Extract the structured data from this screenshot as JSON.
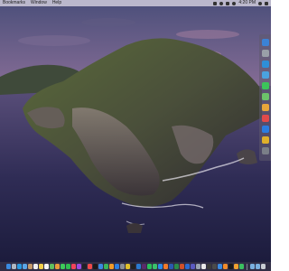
{
  "menubar": {
    "items": [
      "Bookmarks",
      "Window",
      "Help"
    ],
    "clock": "4:20 PM"
  },
  "side_dock": {
    "icons": [
      {
        "name": "finder-icon",
        "color": "#3b82d6"
      },
      {
        "name": "launchpad-icon",
        "color": "#9aa0a8"
      },
      {
        "name": "safari-icon",
        "color": "#2f8fd8"
      },
      {
        "name": "mail-icon",
        "color": "#4aa3e0"
      },
      {
        "name": "messages-icon",
        "color": "#3cc45a"
      },
      {
        "name": "maps-icon",
        "color": "#6cc36a"
      },
      {
        "name": "photos-icon",
        "color": "#e8a63a"
      },
      {
        "name": "calendar-icon",
        "color": "#e24a4a"
      },
      {
        "name": "app-store-icon",
        "color": "#2b7de0"
      },
      {
        "name": "chrome-icon",
        "color": "#e0b02a"
      },
      {
        "name": "settings-icon",
        "color": "#7b7f88"
      }
    ]
  },
  "dock": {
    "icons": [
      {
        "name": "finder-icon",
        "color": "#3a8be0"
      },
      {
        "name": "launchpad-icon",
        "color": "#b0b6c0"
      },
      {
        "name": "safari-icon",
        "color": "#2a9ae0"
      },
      {
        "name": "mail-icon",
        "color": "#5aa5e5"
      },
      {
        "name": "contacts-icon",
        "color": "#c49a6a"
      },
      {
        "name": "calendar-icon",
        "color": "#f0f0f0"
      },
      {
        "name": "notes-icon",
        "color": "#f2d04a"
      },
      {
        "name": "reminders-icon",
        "color": "#f5f5f5"
      },
      {
        "name": "maps-icon",
        "color": "#5fbf5f"
      },
      {
        "name": "photos-icon",
        "color": "#e89a3a"
      },
      {
        "name": "messages-icon",
        "color": "#3ecb5a"
      },
      {
        "name": "facetime-icon",
        "color": "#2fbf4f"
      },
      {
        "name": "music-icon",
        "color": "#f0445a"
      },
      {
        "name": "podcasts-icon",
        "color": "#9a4ae0"
      },
      {
        "name": "tv-icon",
        "color": "#202028"
      },
      {
        "name": "news-icon",
        "color": "#f04a4a"
      },
      {
        "name": "stocks-icon",
        "color": "#1a1a1a"
      },
      {
        "name": "keynote-icon",
        "color": "#3a8ae0"
      },
      {
        "name": "numbers-icon",
        "color": "#3ab35a"
      },
      {
        "name": "pages-icon",
        "color": "#f09a2a"
      },
      {
        "name": "app-store-icon",
        "color": "#2a7de0"
      },
      {
        "name": "system-preferences-icon",
        "color": "#8a8e96"
      },
      {
        "name": "chrome-icon",
        "color": "#e0c02a"
      },
      {
        "name": "terminal-icon",
        "color": "#222222"
      },
      {
        "name": "vscode-icon",
        "color": "#2a7ad0"
      },
      {
        "name": "slack-icon",
        "color": "#5a2a6a"
      },
      {
        "name": "spotify-icon",
        "color": "#2ac05a"
      },
      {
        "name": "whatsapp-icon",
        "color": "#3ac06a"
      },
      {
        "name": "zoom-icon",
        "color": "#2a8ae8"
      },
      {
        "name": "firefox-icon",
        "color": "#f07a2a"
      },
      {
        "name": "word-icon",
        "color": "#2a5ab0"
      },
      {
        "name": "excel-icon",
        "color": "#2a8a4a"
      },
      {
        "name": "powerpoint-icon",
        "color": "#d0502a"
      },
      {
        "name": "outlook-icon",
        "color": "#2a6ad0"
      },
      {
        "name": "teams-icon",
        "color": "#5a5ac0"
      },
      {
        "name": "preview-icon",
        "color": "#9aa4b0"
      },
      {
        "name": "textedit-icon",
        "color": "#e8e8e8"
      },
      {
        "name": "calculator-icon",
        "color": "#3a3a3a"
      },
      {
        "name": "activity-monitor-icon",
        "color": "#4a4a4a"
      },
      {
        "name": "xcode-icon",
        "color": "#3a8ae0"
      },
      {
        "name": "books-icon",
        "color": "#f08a2a"
      },
      {
        "name": "voice-memos-icon",
        "color": "#1a1a1a"
      },
      {
        "name": "home-icon",
        "color": "#f0a030"
      },
      {
        "name": "find-my-icon",
        "color": "#3ac060"
      },
      {
        "name": "downloads-icon",
        "color": "#7ab0e0"
      },
      {
        "name": "documents-icon",
        "color": "#7ab0e0"
      },
      {
        "name": "trash-icon",
        "color": "#c8ccd2"
      }
    ]
  }
}
